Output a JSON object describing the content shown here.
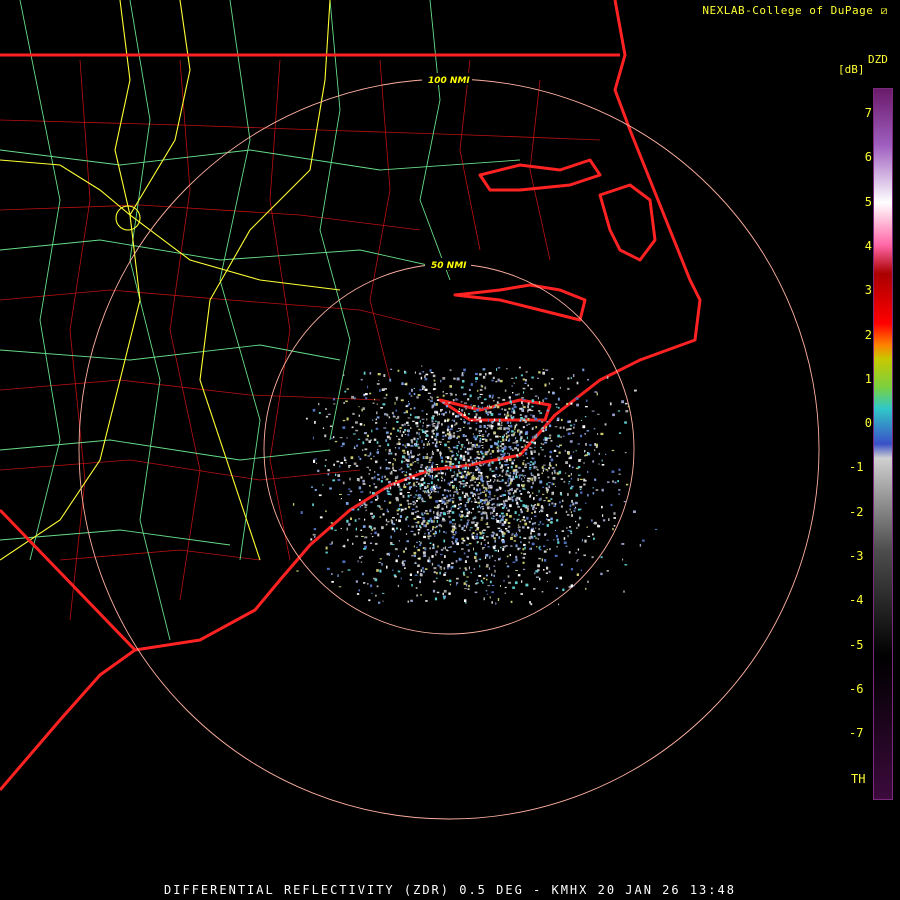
{
  "header": {
    "credit": "NEXLAB-College of DuPage"
  },
  "footer": {
    "caption": "DIFFERENTIAL REFLECTIVITY (ZDR) 0.5 DEG - KMHX 20 JAN 26 13:48"
  },
  "legend": {
    "product": "DZD",
    "units": "[dB]",
    "ticks": [
      "7",
      "6",
      "5",
      "4",
      "3",
      "2",
      "1",
      "0",
      "-1",
      "-2",
      "-3",
      "-4",
      "-5",
      "-6",
      "-7"
    ],
    "threshold_label": "TH",
    "range": [
      -7.5,
      7.5
    ],
    "colors": [
      "#3c0a3c",
      "#000000",
      "#4d4d4d",
      "#9c9c9c",
      "#d0d0d0",
      "#3a50c8",
      "#30c8c8",
      "#c8c800",
      "#ff8000",
      "#ff0000",
      "#ff66a6",
      "#ffffff",
      "#a060c0",
      "#6a1a6a"
    ]
  },
  "range_rings": {
    "labels": [
      "100 NMI",
      "50 NMI"
    ],
    "radii_nmi": [
      100,
      50
    ]
  },
  "colors": {
    "state_borders": "#ff2222",
    "county_lines": "#bb1111",
    "highways": "#66dd88",
    "interstates": "#ffff33",
    "ring": "#ffb0a0"
  }
}
